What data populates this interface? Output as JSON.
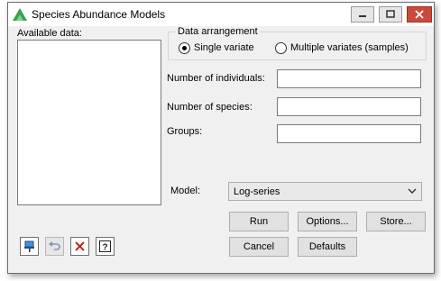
{
  "window": {
    "title": "Species Abundance Models",
    "minimize_icon": "minimize-icon",
    "maximize_icon": "maximize-icon",
    "close_icon": "close-icon"
  },
  "available_data": {
    "label": "Available data:",
    "items": []
  },
  "data_arrangement": {
    "legend": "Data arrangement",
    "options": [
      {
        "label": "Single variate",
        "selected": true
      },
      {
        "label": "Multiple variates (samples)",
        "selected": false
      }
    ]
  },
  "fields": {
    "individuals": {
      "label": "Number of individuals:",
      "value": ""
    },
    "species": {
      "label": "Number of species:",
      "value": ""
    },
    "groups": {
      "label": "Groups:",
      "value": ""
    }
  },
  "model": {
    "label": "Model:",
    "value": "Log-series"
  },
  "buttons": {
    "run": "Run",
    "options": "Options...",
    "store": "Store...",
    "cancel": "Cancel",
    "defaults": "Defaults"
  },
  "toolbar_icons": [
    "pin-icon",
    "undo-icon",
    "clear-icon",
    "help-icon"
  ],
  "colors": {
    "close_button": "#c94a3c",
    "app_icon": "#3a9e4f"
  }
}
